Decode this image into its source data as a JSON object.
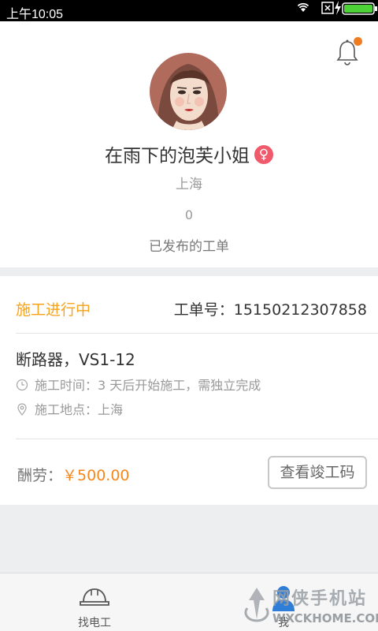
{
  "status_bar": {
    "time": "上午10:05"
  },
  "profile": {
    "username": "在雨下的泡芙小姐",
    "gender_symbol": "♀",
    "city": "上海",
    "published_count": "0",
    "published_label": "已发布的工单",
    "notification_dot_color": "#f07c22"
  },
  "order": {
    "status": "施工进行中",
    "number_label": "工单号：",
    "number": "15150212307858",
    "title": "断路器，VS1-12",
    "time_label": "施工时间：",
    "time_value": "3 天后开始施工，需独立完成",
    "place_label": "施工地点：",
    "place_value": "上海",
    "pay_label": "酬劳：",
    "pay_amount": "￥500.00",
    "verify_button": "查看竣工码",
    "status_color": "#f7a21b"
  },
  "bottom_nav": {
    "items": [
      {
        "label": "找电工",
        "icon": "hardhat-icon"
      },
      {
        "label": "我",
        "icon": "user-icon"
      }
    ]
  },
  "watermark": {
    "name": "网侠手机站",
    "url": "WXCKHOME.COM"
  }
}
